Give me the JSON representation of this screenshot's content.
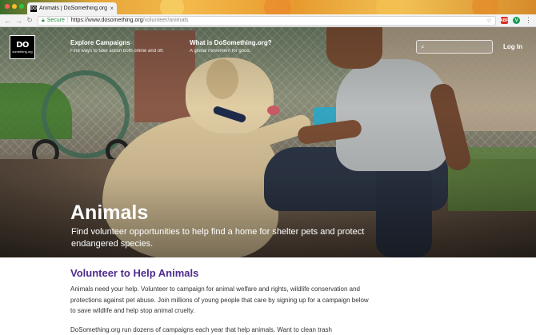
{
  "browser": {
    "tab_title": "Animals | DoSomething.org",
    "tab_favicon_text": "DO",
    "secure_label": "Secure",
    "url_host": "https://www.dosomething.org",
    "url_path": "/volunteer/animals",
    "ext1_text": "ABP",
    "ext1_color": "#d93025",
    "ext2_text": "V",
    "ext2_color": "#1a9e57"
  },
  "site": {
    "logo_main": "DO",
    "logo_sub": "something.org",
    "nav": [
      {
        "title": "Explore Campaigns",
        "subtitle": "Find ways to take action both online and off."
      },
      {
        "title": "What is DoSomething.org?",
        "subtitle": "A global movement for good."
      }
    ],
    "search_placeholder": "",
    "login_label": "Log In"
  },
  "hero": {
    "title": "Animals",
    "subtitle": "Find volunteer opportunities to help find a home for shelter pets and protect endangered species."
  },
  "main": {
    "section_title": "Volunteer to Help Animals",
    "paragraph1": "Animals need your help. Volunteer to campaign for animal welfare and rights, wildlife conservation and protections against pet abuse. Join millions of young people that care by signing up for a campaign below to save wildlife and help stop animal cruelty.",
    "paragraph2": "DoSomething.org run dozens of campaigns each year that help animals. Want to clean trash"
  },
  "colors": {
    "accent_purple": "#4e2a8e",
    "secure_green": "#1e8e3e"
  }
}
